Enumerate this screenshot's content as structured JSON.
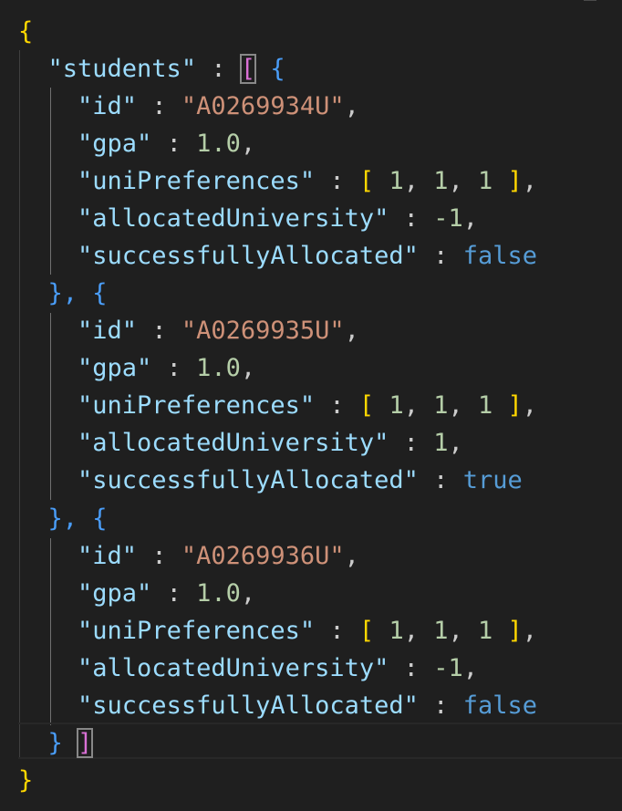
{
  "editor": {
    "language": "json",
    "tokens": {
      "open_root": "{",
      "close_root": "}",
      "students_key": "\"students\"",
      "open_array": "[",
      "close_array": "]",
      "open_obj": "{",
      "close_obj_comma_open": "}, {",
      "close_obj": "}",
      "colon": " : ",
      "comma": ","
    },
    "students": [
      {
        "id_key": "\"id\"",
        "id_value": "\"A0269934U\"",
        "gpa_key": "\"gpa\"",
        "gpa_value": "1.0",
        "prefs_key": "\"uniPreferences\"",
        "prefs_values": [
          "1",
          "1",
          "1"
        ],
        "alloc_key": "\"allocatedUniversity\"",
        "alloc_value": "-1",
        "success_key": "\"successfullyAllocated\"",
        "success_value": "false"
      },
      {
        "id_key": "\"id\"",
        "id_value": "\"A0269935U\"",
        "gpa_key": "\"gpa\"",
        "gpa_value": "1.0",
        "prefs_key": "\"uniPreferences\"",
        "prefs_values": [
          "1",
          "1",
          "1"
        ],
        "alloc_key": "\"allocatedUniversity\"",
        "alloc_value": "1",
        "success_key": "\"successfullyAllocated\"",
        "success_value": "true"
      },
      {
        "id_key": "\"id\"",
        "id_value": "\"A0269936U\"",
        "gpa_key": "\"gpa\"",
        "gpa_value": "1.0",
        "prefs_key": "\"uniPreferences\"",
        "prefs_values": [
          "1",
          "1",
          "1"
        ],
        "alloc_key": "\"allocatedUniversity\"",
        "alloc_value": "-1",
        "success_key": "\"successfullyAllocated\"",
        "success_value": "false"
      }
    ],
    "colors": {
      "background": "#1f1f1f",
      "key": "#9cdcfe",
      "string": "#ce9178",
      "number": "#b5cea8",
      "boolean": "#569cd6",
      "bracket_level1": "#ffd700",
      "bracket_level2": "#da70d6",
      "bracket_level3": "#4a9df8"
    }
  }
}
